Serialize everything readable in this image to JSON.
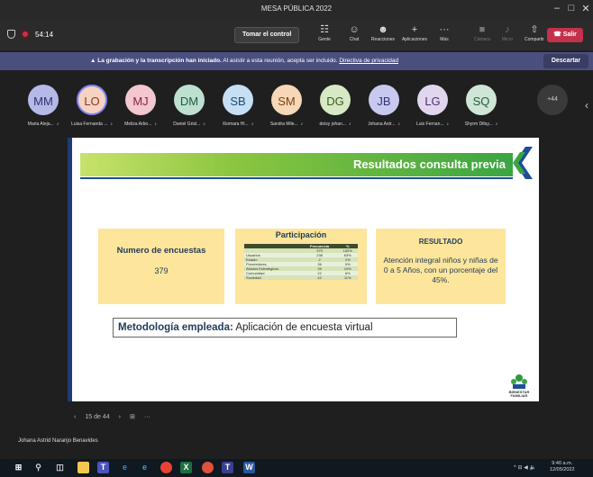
{
  "window": {
    "title": "MESA PÚBLICA 2022"
  },
  "toolbar": {
    "timer": "54:14",
    "take_control": "Tomar el control",
    "items": [
      {
        "icon": "people-icon",
        "glyph": "☷",
        "label": "Gente"
      },
      {
        "icon": "chat-icon",
        "glyph": "☺",
        "label": "Chat"
      },
      {
        "icon": "reactions-icon",
        "glyph": "☻",
        "label": "Reacciones"
      },
      {
        "icon": "apps-icon",
        "glyph": "+",
        "label": "Aplicaciones"
      },
      {
        "icon": "more-icon",
        "glyph": "···",
        "label": "Más"
      },
      {
        "icon": "camera-icon",
        "glyph": "■",
        "label": "Cámara"
      },
      {
        "icon": "mic-icon",
        "glyph": "♪",
        "label": "Micro"
      },
      {
        "icon": "share-icon",
        "glyph": "⇧",
        "label": "Compartir"
      }
    ],
    "leave": "Salir"
  },
  "banner": {
    "bold": "La grabación y la transcripción han iniciado.",
    "text": " Al asistir a esta reunión, acepta ser incluido. ",
    "link": "Directiva de privacidad",
    "dismiss": "Descartar"
  },
  "participants": [
    {
      "initials": "MM",
      "name": "Maria Aleja...",
      "bg": "#b4b9e8",
      "fg": "#2d2f6b"
    },
    {
      "initials": "LO",
      "name": "Luisa Fernanda ...",
      "bg": "#f5d2c2",
      "fg": "#8a3a1f",
      "active": true
    },
    {
      "initials": "MJ",
      "name": "Meliza Arbo...",
      "bg": "#f3c7cf",
      "fg": "#8a2338"
    },
    {
      "initials": "DM",
      "name": "Daniel Grisl...",
      "bg": "#bde0d0",
      "fg": "#1f5c43"
    },
    {
      "initials": "SB",
      "name": "Xiomara Hi...",
      "bg": "#c6dff3",
      "fg": "#1d4a73"
    },
    {
      "initials": "SM",
      "name": "Sandra Mile...",
      "bg": "#f6d7b8",
      "fg": "#7a4210"
    },
    {
      "initials": "DG",
      "name": "deisy johan...",
      "bg": "#d6e9c4",
      "fg": "#3b5a1e"
    },
    {
      "initials": "JB",
      "name": "Johana Astr...",
      "bg": "#c8c9ee",
      "fg": "#34357a"
    },
    {
      "initials": "LG",
      "name": "Luis Fernan...",
      "bg": "#e2d6ef",
      "fg": "#4e3170"
    },
    {
      "initials": "SQ",
      "name": "Shyrm Difay...",
      "bg": "#cfe6d6",
      "fg": "#245c38"
    }
  ],
  "more_participants": "+44",
  "slide": {
    "title": "Resultados consulta previa",
    "box1": {
      "heading": "Numero de encuestas",
      "value": "379"
    },
    "box2": {
      "heading": "Participación",
      "columns": [
        "",
        "Frecuencia",
        "%"
      ],
      "rows": [
        [
          "",
          "379",
          "100%"
        ],
        [
          "Usuarios",
          "238",
          "63%"
        ],
        [
          "Estado",
          "2",
          "1%"
        ],
        [
          "Proveedores",
          "36",
          "9%"
        ],
        [
          "Aliados Estratégicos",
          "39",
          "10%"
        ],
        [
          "Comunidad",
          "22",
          "6%"
        ],
        [
          "Sociedad",
          "42",
          "11%"
        ]
      ]
    },
    "box3": {
      "heading": "RESULTADO",
      "text": "Atención integral niños y niñas de 0 a 5 Años, con un porcentaje del 45%."
    },
    "method_label": "Metodología empleada:",
    "method_text": " Aplicación de encuesta virtual",
    "logo_text": "BIENESTAR FAMILIAR"
  },
  "slidenav": {
    "prev": "‹",
    "page": "15 de 44",
    "next": "›",
    "grid": "⊞",
    "more": "···"
  },
  "presenter": "Johana Astrid Naranjo Benavides",
  "taskbar": {
    "tray": "^ ⊟ ◀ 🔈",
    "time": "9:40 a.m.",
    "date": "12/05/2022"
  }
}
